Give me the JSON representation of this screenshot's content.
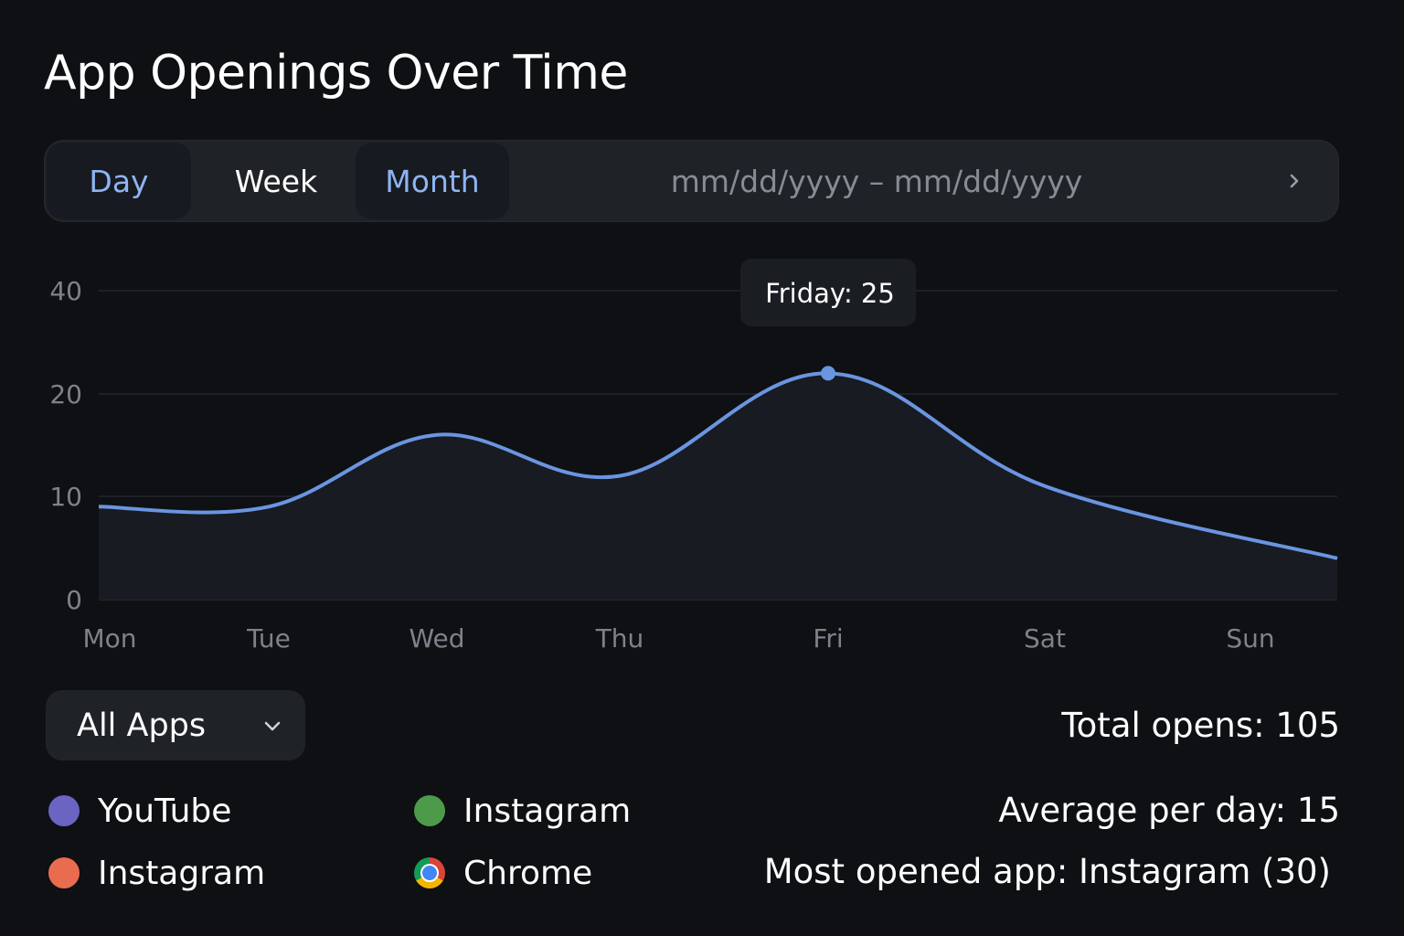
{
  "title": "App Openings Over Time",
  "range_selector": {
    "tabs": [
      "Day",
      "Week",
      "Month"
    ],
    "date_range": "mm/dd/yyyy – mm/dd/yyyy"
  },
  "chart_data": {
    "type": "area",
    "categories": [
      "Mon",
      "Tue",
      "Wed",
      "Thu",
      "Fri",
      "Sat",
      "Sun"
    ],
    "values": [
      9,
      9,
      16,
      12,
      24,
      11,
      4
    ],
    "yticks": [
      "40",
      "20",
      "10",
      "0"
    ],
    "grid": true,
    "line_color": "#6a95e0",
    "fill_color": "#181b22",
    "highlight": {
      "category": "Fri",
      "label": "Friday: 25"
    }
  },
  "filter": {
    "selected": "All Apps"
  },
  "legend": [
    {
      "label": "YouTube",
      "color": "#6b64c2"
    },
    {
      "label": "Instagram",
      "color": "#4d9a4a"
    },
    {
      "label": "Instagram",
      "color": "#ea6c4e"
    },
    {
      "label": "Chrome",
      "color": "chrome",
      "icon": "chrome-icon"
    }
  ],
  "stats": {
    "total": "Total opens: 105",
    "average": "Average per day: 15",
    "most_opened": "Most opened app: Instagram (30)"
  }
}
